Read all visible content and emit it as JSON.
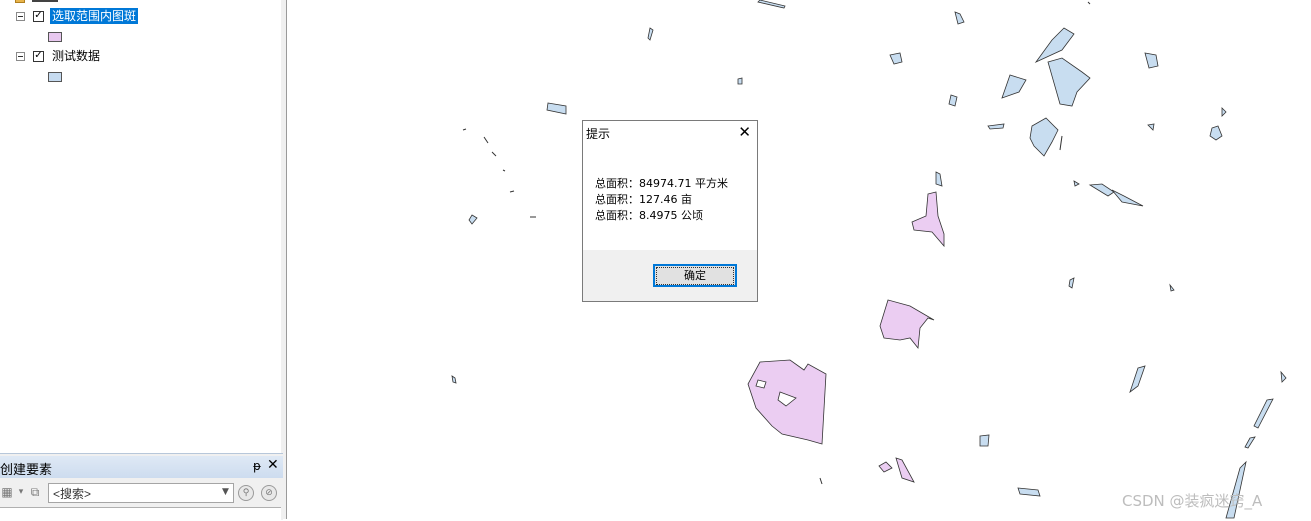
{
  "toc": {
    "layers": [
      {
        "label": "选取范围内图斑",
        "checked": "✓",
        "fill": "#e8c8ef",
        "selected": true
      },
      {
        "label": "测试数据",
        "checked": "✓",
        "fill": "#c6dbf0",
        "selected": false
      }
    ]
  },
  "create_features": {
    "title": "创建要素",
    "pin": "ᵽ",
    "close": "✕",
    "search_placeholder": "<搜索>"
  },
  "dialog": {
    "title": "提示",
    "close_glyph": "✕",
    "lines": [
      "总面积：84974.71 平方米",
      "总面积：127.46 亩",
      "总面积：8.4975 公顷"
    ],
    "ok_label": "确定"
  },
  "map": {
    "selected_fill": "#ebcdf2",
    "other_fill": "#c8ddf0",
    "outline": "#333333"
  },
  "watermark": "CSDN @装疯迷窍_A"
}
